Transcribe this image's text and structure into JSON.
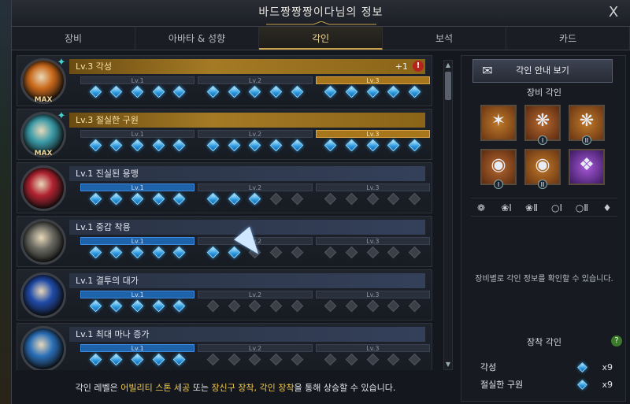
{
  "window": {
    "title": "바드짱짱짱이다님의 정보",
    "close_label": "X"
  },
  "tabs": [
    {
      "label": "장비",
      "active": false
    },
    {
      "label": "아바타 & 성향",
      "active": false
    },
    {
      "label": "각인",
      "active": true
    },
    {
      "label": "보석",
      "active": false
    },
    {
      "label": "카드",
      "active": false
    }
  ],
  "engravings": [
    {
      "title": "Lv.3 각성",
      "style": "gold",
      "badge": "MAX",
      "plus": "+1",
      "warning": "!",
      "medal_color": "#c9681a",
      "levels": [
        {
          "label": "Lv.1",
          "style": "plain",
          "gems": 5,
          "filled": 5
        },
        {
          "label": "Lv.2",
          "style": "plain",
          "gems": 5,
          "filled": 5
        },
        {
          "label": "Lv.3",
          "style": "gold",
          "gems": 5,
          "filled": 5
        }
      ]
    },
    {
      "title": "Lv.3 절실한 구원",
      "style": "gold",
      "badge": "MAX",
      "plus": "",
      "warning": "",
      "medal_color": "#3a9aa8",
      "levels": [
        {
          "label": "Lv.1",
          "style": "plain",
          "gems": 5,
          "filled": 5
        },
        {
          "label": "Lv.2",
          "style": "plain",
          "gems": 5,
          "filled": 5
        },
        {
          "label": "Lv.3",
          "style": "gold",
          "gems": 5,
          "filled": 5
        }
      ]
    },
    {
      "title": "Lv.1 진실된 용맹",
      "style": "blue",
      "badge": "",
      "plus": "",
      "warning": "",
      "medal_color": "#b02230",
      "levels": [
        {
          "label": "Lv.1",
          "style": "blue",
          "gems": 5,
          "filled": 5
        },
        {
          "label": "Lv.2",
          "style": "plain",
          "gems": 5,
          "filled": 3
        },
        {
          "label": "Lv.3",
          "style": "plain",
          "gems": 5,
          "filled": 0
        }
      ]
    },
    {
      "title": "Lv.1 중갑 착용",
      "style": "blue",
      "badge": "",
      "plus": "",
      "warning": "",
      "medal_color": "#6a6a62",
      "levels": [
        {
          "label": "Lv.1",
          "style": "blue",
          "gems": 5,
          "filled": 5
        },
        {
          "label": "Lv.2",
          "style": "plain",
          "gems": 5,
          "filled": 2
        },
        {
          "label": "Lv.3",
          "style": "plain",
          "gems": 5,
          "filled": 0
        }
      ]
    },
    {
      "title": "Lv.1 결투의 대가",
      "style": "blue",
      "badge": "",
      "plus": "",
      "warning": "",
      "medal_color": "#1f4aa8",
      "levels": [
        {
          "label": "Lv.1",
          "style": "blue",
          "gems": 5,
          "filled": 5
        },
        {
          "label": "Lv.2",
          "style": "plain",
          "gems": 5,
          "filled": 0
        },
        {
          "label": "Lv.3",
          "style": "plain",
          "gems": 5,
          "filled": 0
        }
      ]
    },
    {
      "title": "Lv.1 최대 마나 증가",
      "style": "blue",
      "badge": "",
      "plus": "",
      "warning": "",
      "medal_color": "#2a6fb8",
      "levels": [
        {
          "label": "Lv.1",
          "style": "blue",
          "gems": 5,
          "filled": 5
        },
        {
          "label": "Lv.2",
          "style": "plain",
          "gems": 5,
          "filled": 0
        },
        {
          "label": "Lv.3",
          "style": "plain",
          "gems": 5,
          "filled": 0
        }
      ]
    }
  ],
  "footer": {
    "part1": "각인 레벨은 ",
    "hl1": "어빌리티 스톤 세공",
    "part2": " 또는 ",
    "hl2": "장신구 장착, 각인 장착",
    "part3": "을 통해 상승할 수 있습니다."
  },
  "right_panel": {
    "guide_label": "각인 안내 보기",
    "guide_icon": "book-icon",
    "equip_title": "장비 각인",
    "slots": [
      {
        "name": "necklace-slot",
        "glyph": "✶",
        "num": ""
      },
      {
        "name": "earring-1-slot",
        "glyph": "❋",
        "num": "I"
      },
      {
        "name": "earring-2-slot",
        "glyph": "❋",
        "num": "II"
      },
      {
        "name": "ring-1-slot",
        "glyph": "◉",
        "num": "I"
      },
      {
        "name": "ring-2-slot",
        "glyph": "◉",
        "num": "II"
      },
      {
        "name": "ability-stone-slot",
        "glyph": "❖",
        "num": ""
      }
    ],
    "accessory_tabs": [
      "❁",
      "❀Ⅰ",
      "❀Ⅱ",
      "○Ⅰ",
      "○Ⅱ",
      "♦"
    ],
    "accessory_info": "장비별로 각인 정보를 확인할 수 있습니다.",
    "worn_title": "장착 각인",
    "help_label": "?",
    "worn": [
      {
        "name": "각성",
        "count": "x9"
      },
      {
        "name": "절실한 구원",
        "count": "x9"
      }
    ]
  }
}
